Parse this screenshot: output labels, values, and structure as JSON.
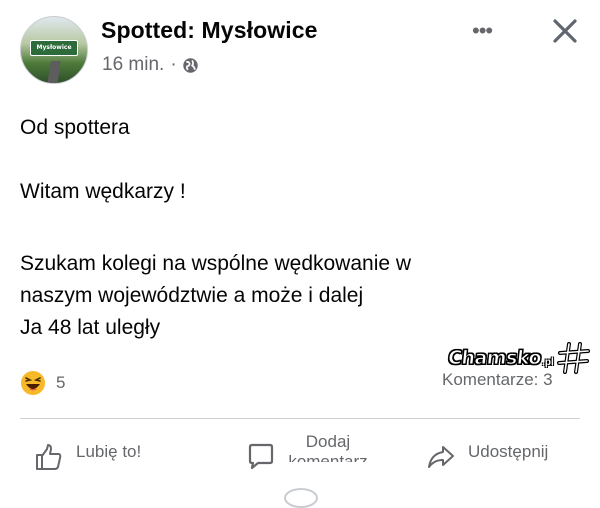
{
  "header": {
    "page_name": "Spotted: Mysłowice",
    "avatar_sign_text": "Mysłowice",
    "time": "16 min.",
    "separator": "·",
    "privacy_icon": "globe-icon",
    "more_icon": "more-horizontal-icon",
    "more_text": "•••",
    "close_icon": "close-icon"
  },
  "post": {
    "line1": "Od spottera",
    "line2": "Witam wędkarzy !",
    "line3": "Szukam kolegi na wspólne wędkowanie w",
    "line4": "naszym województwie a może i dalej",
    "line5": "Ja 48 lat uległy"
  },
  "stats": {
    "reaction_icon": "haha-emoji-icon",
    "reaction_count": "5",
    "comments": "Komentarze: 3"
  },
  "watermark": {
    "text": "Chamsko",
    "suffix": ".pl"
  },
  "actions": {
    "like_label": "Lubię to!",
    "like_icon": "thumbs-up-icon",
    "comment_label_line1": "Dodaj",
    "comment_label_line2": "komentarz",
    "comment_icon": "comment-bubble-icon",
    "share_label": "Udostępnij",
    "share_icon": "share-arrow-icon"
  },
  "colors": {
    "text": "#050505",
    "secondary": "#65676b",
    "divider": "#ced0d4",
    "haha_yellow": "#f7b928"
  }
}
